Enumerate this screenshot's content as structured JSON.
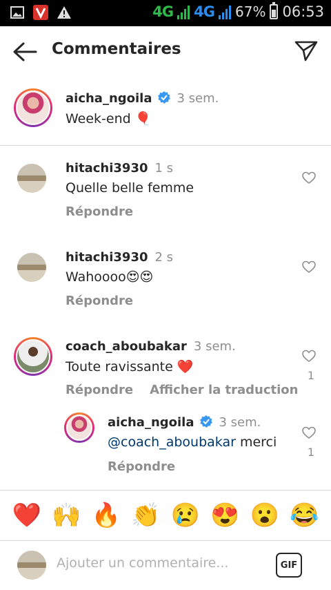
{
  "status_bar": {
    "network1": "4G",
    "network2": "4G",
    "battery": "67%",
    "time": "06:53",
    "battery_level": 0.67
  },
  "header": {
    "title": "Commentaires"
  },
  "caption": {
    "username": "aicha_ngoila",
    "time": "3 sem.",
    "text": "Week-end 🎈"
  },
  "comments": [
    {
      "username": "hitachi3930",
      "time": "1 s",
      "text": "Quelle belle femme",
      "reply_label": "Répondre"
    },
    {
      "username": "hitachi3930",
      "time": "2 s",
      "text": "Wahoooo😍😍",
      "reply_label": "Répondre"
    },
    {
      "username": "coach_aboubakar",
      "time": "3 sem.",
      "text": "Toute ravissante ❤️",
      "reply_label": "Répondre",
      "translate_label": "Afficher la traduction",
      "likes": "1"
    },
    {
      "username": "aicha_ngoila",
      "time": "3 sem.",
      "mention": "@coach_aboubakar",
      "text": " merci",
      "reply_label": "Répondre",
      "likes": "1"
    }
  ],
  "emoji_bar": [
    "❤️",
    "🙌",
    "🔥",
    "👏",
    "😢",
    "😍",
    "😮",
    "😂"
  ],
  "composer": {
    "placeholder": "Ajouter un commentaire...",
    "gif_label": "GIF"
  },
  "colors": {
    "verified": "#3897f0",
    "muted": "#8e8e8e",
    "mention": "#00376b"
  }
}
